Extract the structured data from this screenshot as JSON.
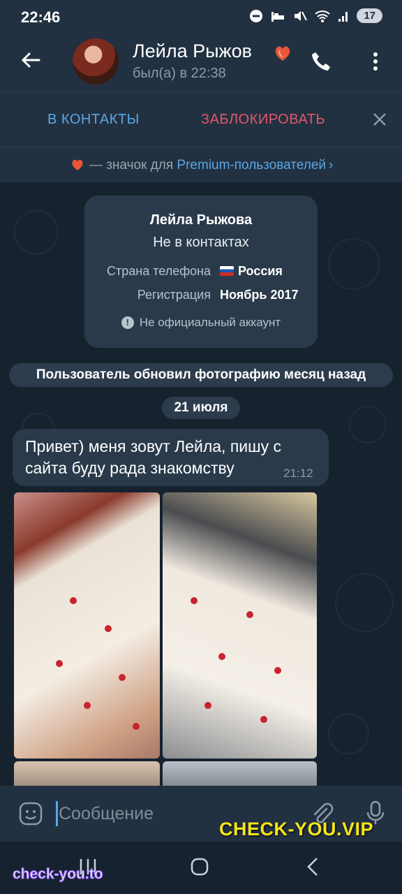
{
  "status_bar": {
    "time": "22:46",
    "battery": "17"
  },
  "header": {
    "name": "Лейла Рыжов",
    "status": "был(а) в 22:38"
  },
  "actions": {
    "add_contact": "В КОНТАКТЫ",
    "block": "ЗАБЛОКИРОВАТЬ"
  },
  "premium": {
    "text_before": " — значок для ",
    "link": "Premium-пользователей",
    "chevron": "›"
  },
  "info_card": {
    "name": "Лейла Рыжова",
    "subtitle": "Не в контактах",
    "rows": [
      {
        "label": "Страна телефона",
        "value": "Россия"
      },
      {
        "label": "Регистрация",
        "value": "Ноябрь 2017"
      }
    ],
    "unofficial": "Не официальный аккаунт"
  },
  "service_message": "Пользователь обновил фотографию месяц назад",
  "date_separator": "21 июля",
  "message": {
    "text": "Привет) меня зовут Лейла, пишу с сайта буду рада знакомству",
    "time": "21:12"
  },
  "input": {
    "placeholder": "Сообщение"
  },
  "watermarks": {
    "vip": "CHECK-YOU.VIP",
    "to": "check-you.to"
  },
  "colors": {
    "accent": "#5ba7e6",
    "danger": "#e2586a",
    "background": "#17222f"
  }
}
